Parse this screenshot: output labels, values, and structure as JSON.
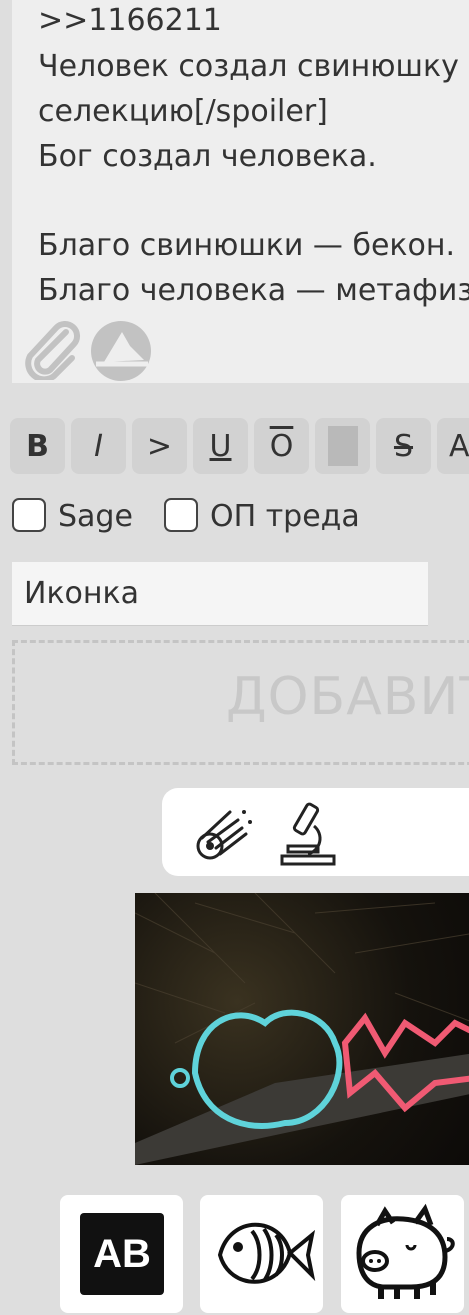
{
  "post_textarea": {
    "lines": [
      ">>1166211",
      "Человек создал свинюшку",
      "селекцию[/spoiler]",
      "Бог создал человека.",
      "",
      "Благо свинюшки — бекон.",
      "Благо человека — метафиз"
    ],
    "attach_icon": "paperclip-icon",
    "paint_icon": "drawing-icon"
  },
  "format_toolbar": {
    "buttons": [
      {
        "label": "B",
        "name": "bold-button"
      },
      {
        "label": "I",
        "name": "italic-button"
      },
      {
        "label": ">",
        "name": "quote-button"
      },
      {
        "label": "U",
        "name": "underline-button"
      },
      {
        "label": "O",
        "name": "overline-button"
      },
      {
        "label": "",
        "name": "spoiler-button"
      },
      {
        "label": "S",
        "name": "strikethrough-button"
      },
      {
        "label": "A",
        "name": "superscript-button"
      }
    ]
  },
  "options": {
    "sage_label": "Sage",
    "op_label": "ОП треда",
    "sage_checked": false,
    "op_checked": false
  },
  "icon_select": {
    "value": "Иконка"
  },
  "dropzone": {
    "label": "ДОБАВИТЬ"
  },
  "mode_icons": [
    "comet-icon",
    "microscope-icon"
  ],
  "attached_image": {
    "description_icon": "image-thumbnail"
  },
  "bottom_tiles": [
    {
      "label": "AB",
      "name": "text-sticker-tile"
    },
    {
      "label": "",
      "name": "fish-sticker-tile"
    },
    {
      "label": "",
      "name": "pig-sticker-tile"
    }
  ],
  "colors": {
    "background": "#dedede",
    "textarea": "#eeeeee",
    "button": "#d2d2d2",
    "spoiler": "#b9b9b9",
    "teal_outline": "#5fd3da",
    "pink_outline": "#f05a73"
  }
}
